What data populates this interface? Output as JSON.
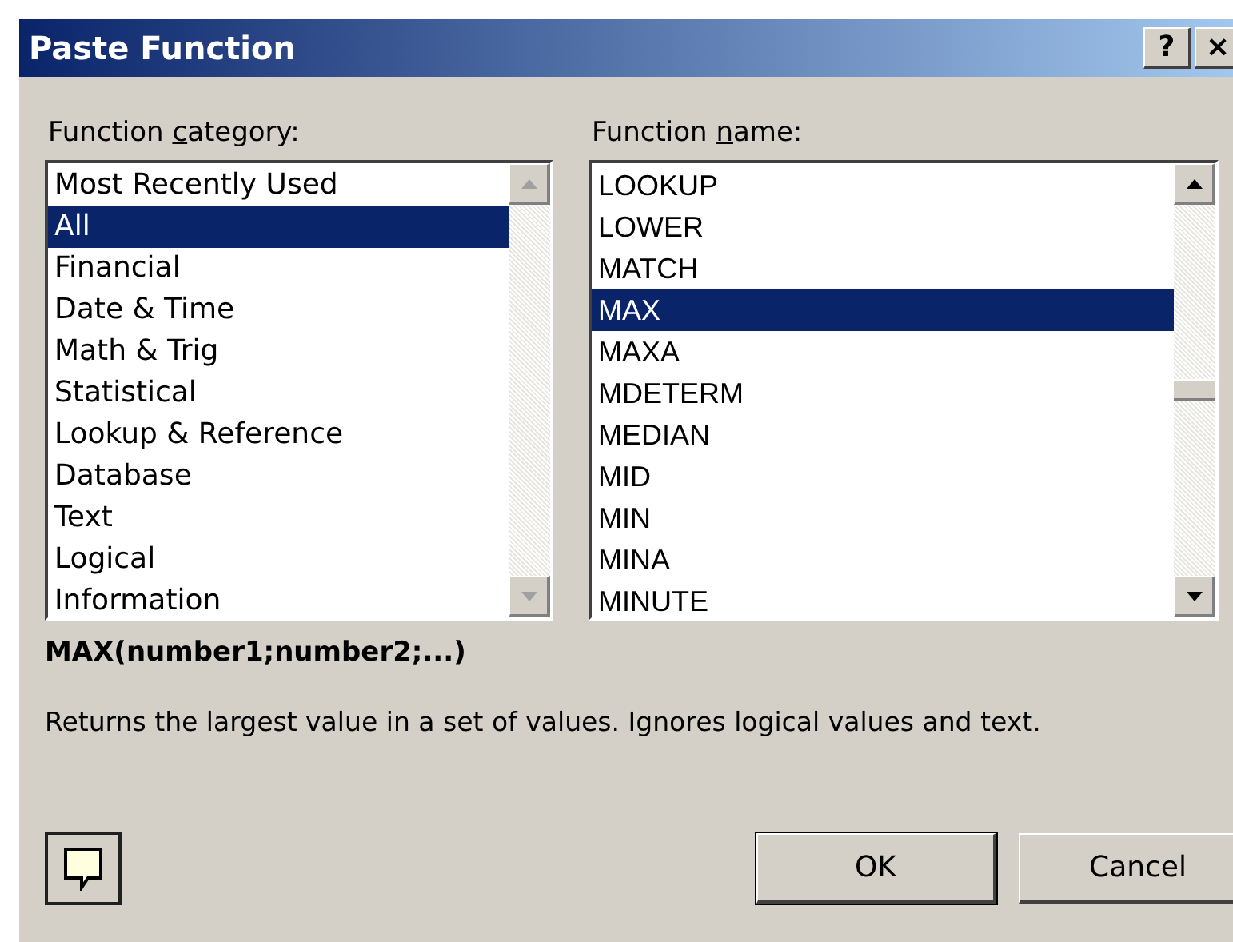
{
  "window": {
    "title": "Paste Function",
    "title_buttons": [
      "?",
      "×"
    ]
  },
  "category": {
    "label_before": "Function ",
    "access_key": "c",
    "label_after": "ategory:",
    "scroll_enabled": false,
    "items": [
      {
        "label": "Most Recently Used",
        "selected": false
      },
      {
        "label": "All",
        "selected": true
      },
      {
        "label": "Financial",
        "selected": false
      },
      {
        "label": "Date & Time",
        "selected": false
      },
      {
        "label": "Math & Trig",
        "selected": false
      },
      {
        "label": "Statistical",
        "selected": false
      },
      {
        "label": "Lookup & Reference",
        "selected": false
      },
      {
        "label": "Database",
        "selected": false
      },
      {
        "label": "Text",
        "selected": false
      },
      {
        "label": "Logical",
        "selected": false
      },
      {
        "label": "Information",
        "selected": false
      }
    ]
  },
  "function_name": {
    "label_before": "Function ",
    "access_key": "n",
    "label_after": "ame:",
    "scroll_enabled": true,
    "items": [
      {
        "label": "LOOKUP",
        "selected": false
      },
      {
        "label": "LOWER",
        "selected": false
      },
      {
        "label": "MATCH",
        "selected": false
      },
      {
        "label": "MAX",
        "selected": true
      },
      {
        "label": "MAXA",
        "selected": false
      },
      {
        "label": "MDETERM",
        "selected": false
      },
      {
        "label": "MEDIAN",
        "selected": false
      },
      {
        "label": "MID",
        "selected": false
      },
      {
        "label": "MIN",
        "selected": false
      },
      {
        "label": "MINA",
        "selected": false
      },
      {
        "label": "MINUTE",
        "selected": false
      }
    ]
  },
  "syntax": "MAX(number1;number2;...)",
  "description": "Returns the largest value in a set of values. Ignores logical values and text.",
  "buttons": [
    "OK",
    "Cancel"
  ]
}
